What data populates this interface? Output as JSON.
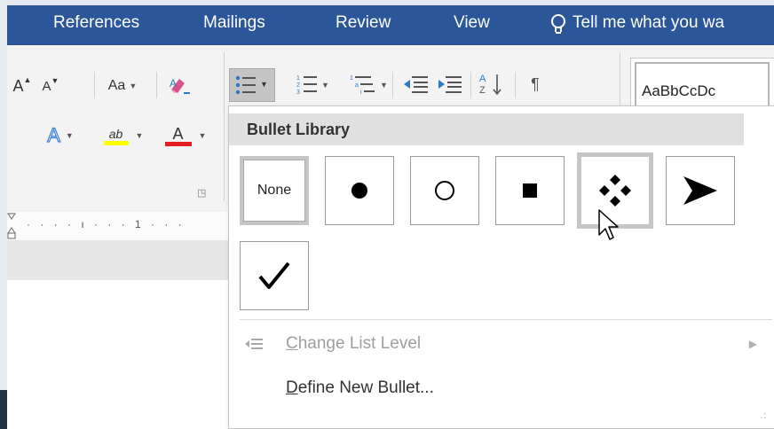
{
  "ribbon_tabs": [
    {
      "label": "References"
    },
    {
      "label": "Mailings"
    },
    {
      "label": "Review"
    },
    {
      "label": "View"
    }
  ],
  "tell_me": {
    "label": "Tell me what you wa"
  },
  "font_group": {
    "grow_font": "A",
    "shrink_font": "A",
    "change_case": "Aa",
    "text_effects": "A",
    "highlight": "ab",
    "font_color": "A"
  },
  "paragraph_group": {
    "sort_label": "A Z",
    "show_marks": "¶"
  },
  "styles": {
    "sample": "AaBbCcDc"
  },
  "ruler": {
    "marks": "· · · · ı · · · 1 · · ·"
  },
  "bullet_menu": {
    "header": "Bullet Library",
    "cells": [
      {
        "label": "None",
        "icon": "none"
      },
      {
        "label": "●",
        "icon": "filled-circle-bullet"
      },
      {
        "label": "○",
        "icon": "hollow-circle-bullet"
      },
      {
        "label": "■",
        "icon": "filled-square-bullet"
      },
      {
        "label": "❖",
        "icon": "four-diamond-bullet"
      },
      {
        "label": "➢",
        "icon": "arrowhead-bullet"
      },
      {
        "label": "✓",
        "icon": "checkmark-bullet"
      }
    ],
    "change_level": {
      "prefix": "C",
      "rest": "hange List Level"
    },
    "define_new": {
      "prefix": "D",
      "rest": "efine New Bullet..."
    }
  },
  "colors": {
    "tab_bar": "#2b579a",
    "highlight_yellow": "#ffff00",
    "font_color_red": "#e51c23"
  }
}
